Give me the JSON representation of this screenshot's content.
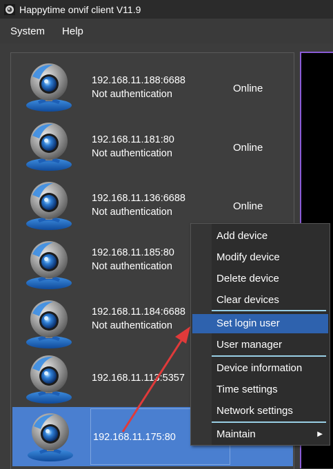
{
  "window": {
    "title": "Happytime onvif client V11.9",
    "app_icon": "camera-app-icon"
  },
  "menubar": {
    "items": [
      {
        "label": "System"
      },
      {
        "label": "Help"
      }
    ]
  },
  "devices": [
    {
      "address": "192.168.11.188:6688",
      "auth": "Not authentication",
      "status": "Online",
      "icon": "webcam-icon"
    },
    {
      "address": "192.168.11.181:80",
      "auth": "Not authentication",
      "status": "Online",
      "icon": "webcam-icon"
    },
    {
      "address": "192.168.11.136:6688",
      "auth": "Not authentication",
      "status": "Online",
      "icon": "webcam-icon"
    },
    {
      "address": "192.168.11.185:80",
      "auth": "Not authentication",
      "status": "",
      "icon": "webcam-icon"
    },
    {
      "address": "192.168.11.184:6688",
      "auth": "Not authentication",
      "status": "",
      "icon": "webcam-icon"
    },
    {
      "address": "192.168.11.113:5357",
      "auth": "",
      "status": "",
      "icon": "webcam-icon"
    },
    {
      "address": "192.168.11.175:80",
      "auth": "",
      "status": "",
      "icon": "webcam-icon",
      "selected": true
    }
  ],
  "context_menu": {
    "items": [
      {
        "label": "Add device"
      },
      {
        "label": "Modify device"
      },
      {
        "label": "Delete device"
      },
      {
        "label": "Clear devices"
      },
      {
        "label": "Set login user",
        "highlighted": true
      },
      {
        "label": "User manager"
      },
      {
        "label": "Device information"
      },
      {
        "label": "Time settings"
      },
      {
        "label": "Network settings"
      },
      {
        "label": "Maintain",
        "has_submenu": true
      }
    ]
  },
  "colors": {
    "background": "#3c3c3c",
    "selection": "#4a7fd0",
    "menu_highlight": "#2e62ae",
    "annotation_arrow": "#e03a3a",
    "preview_border": "#8a5bd6"
  }
}
